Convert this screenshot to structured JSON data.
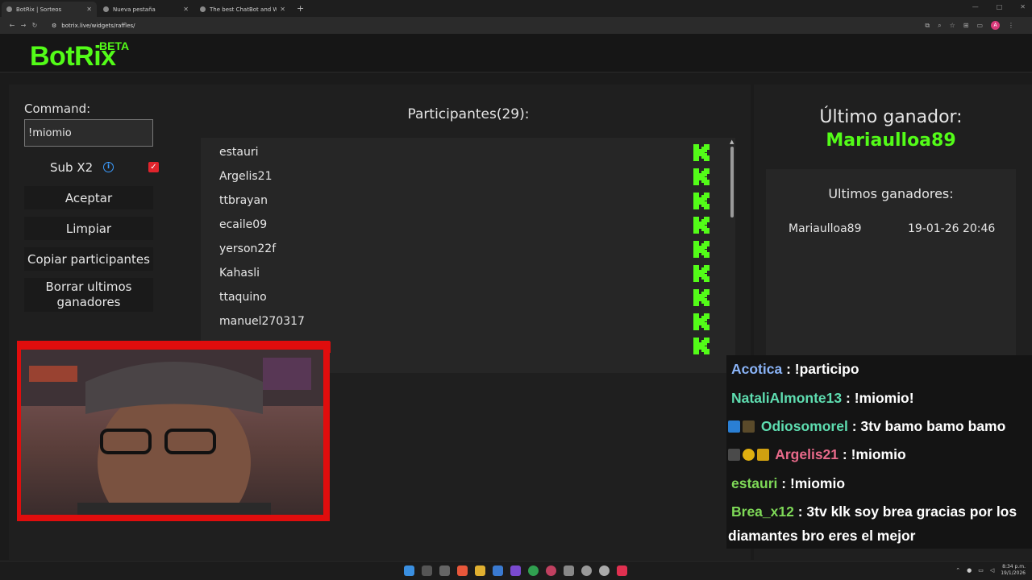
{
  "browser": {
    "tabs": [
      {
        "title": "BotRix | Sorteos",
        "active": true
      },
      {
        "title": "Nueva pestaña",
        "active": false
      },
      {
        "title": "The best ChatBot and Widgets",
        "active": false
      }
    ],
    "new_tab": "+",
    "url": "botrix.live/widgets/raffles/",
    "profile_initial": "A"
  },
  "header": {
    "logo": "BotRix",
    "badge": "BETA"
  },
  "controls": {
    "command_label": "Command:",
    "command_value": "!miomio",
    "sub_label": "Sub X2",
    "info_symbol": "i",
    "sub_checked": true,
    "accept_label": "Aceptar",
    "clear_label": "Limpiar",
    "copy_label": "Copiar participantes",
    "delete_label": "Borrar ultimos ganadores"
  },
  "participants": {
    "title": "Participantes(29):",
    "count": 29,
    "visible_names": [
      "estauri",
      "Argelis21",
      "ttbrayan",
      "ecaile09",
      "yerson22f",
      "Kahasli",
      "ttaquino",
      "manuel270317"
    ],
    "platform_icon": "kick-icon",
    "accent": "#53fc18"
  },
  "winner": {
    "title": "Último ganador:",
    "name": "Mariaulloa89",
    "recent_title": "Ultimos ganadores:",
    "recent": [
      {
        "name": "Mariaulloa89",
        "date": "19-01-26 20:46"
      }
    ]
  },
  "chat": [
    {
      "user": "Acotica",
      "text": ": !participo"
    },
    {
      "user": "NataliAlmonte13",
      "text": ": !miomio!"
    },
    {
      "user": "Odiosomorel",
      "text": ": 3tv bamo bamo bamo"
    },
    {
      "user": "Argelis21",
      "text": ": !miomio"
    },
    {
      "user": "estauri",
      "text": ": !miomio"
    },
    {
      "user": "Brea_x12",
      "text": ": 3tv klk soy brea gracias por los",
      "continuation": "diamantes bro eres el mejor"
    }
  ],
  "taskbar": {
    "time": "8:34 p.m.",
    "date": "19/1/2026"
  }
}
